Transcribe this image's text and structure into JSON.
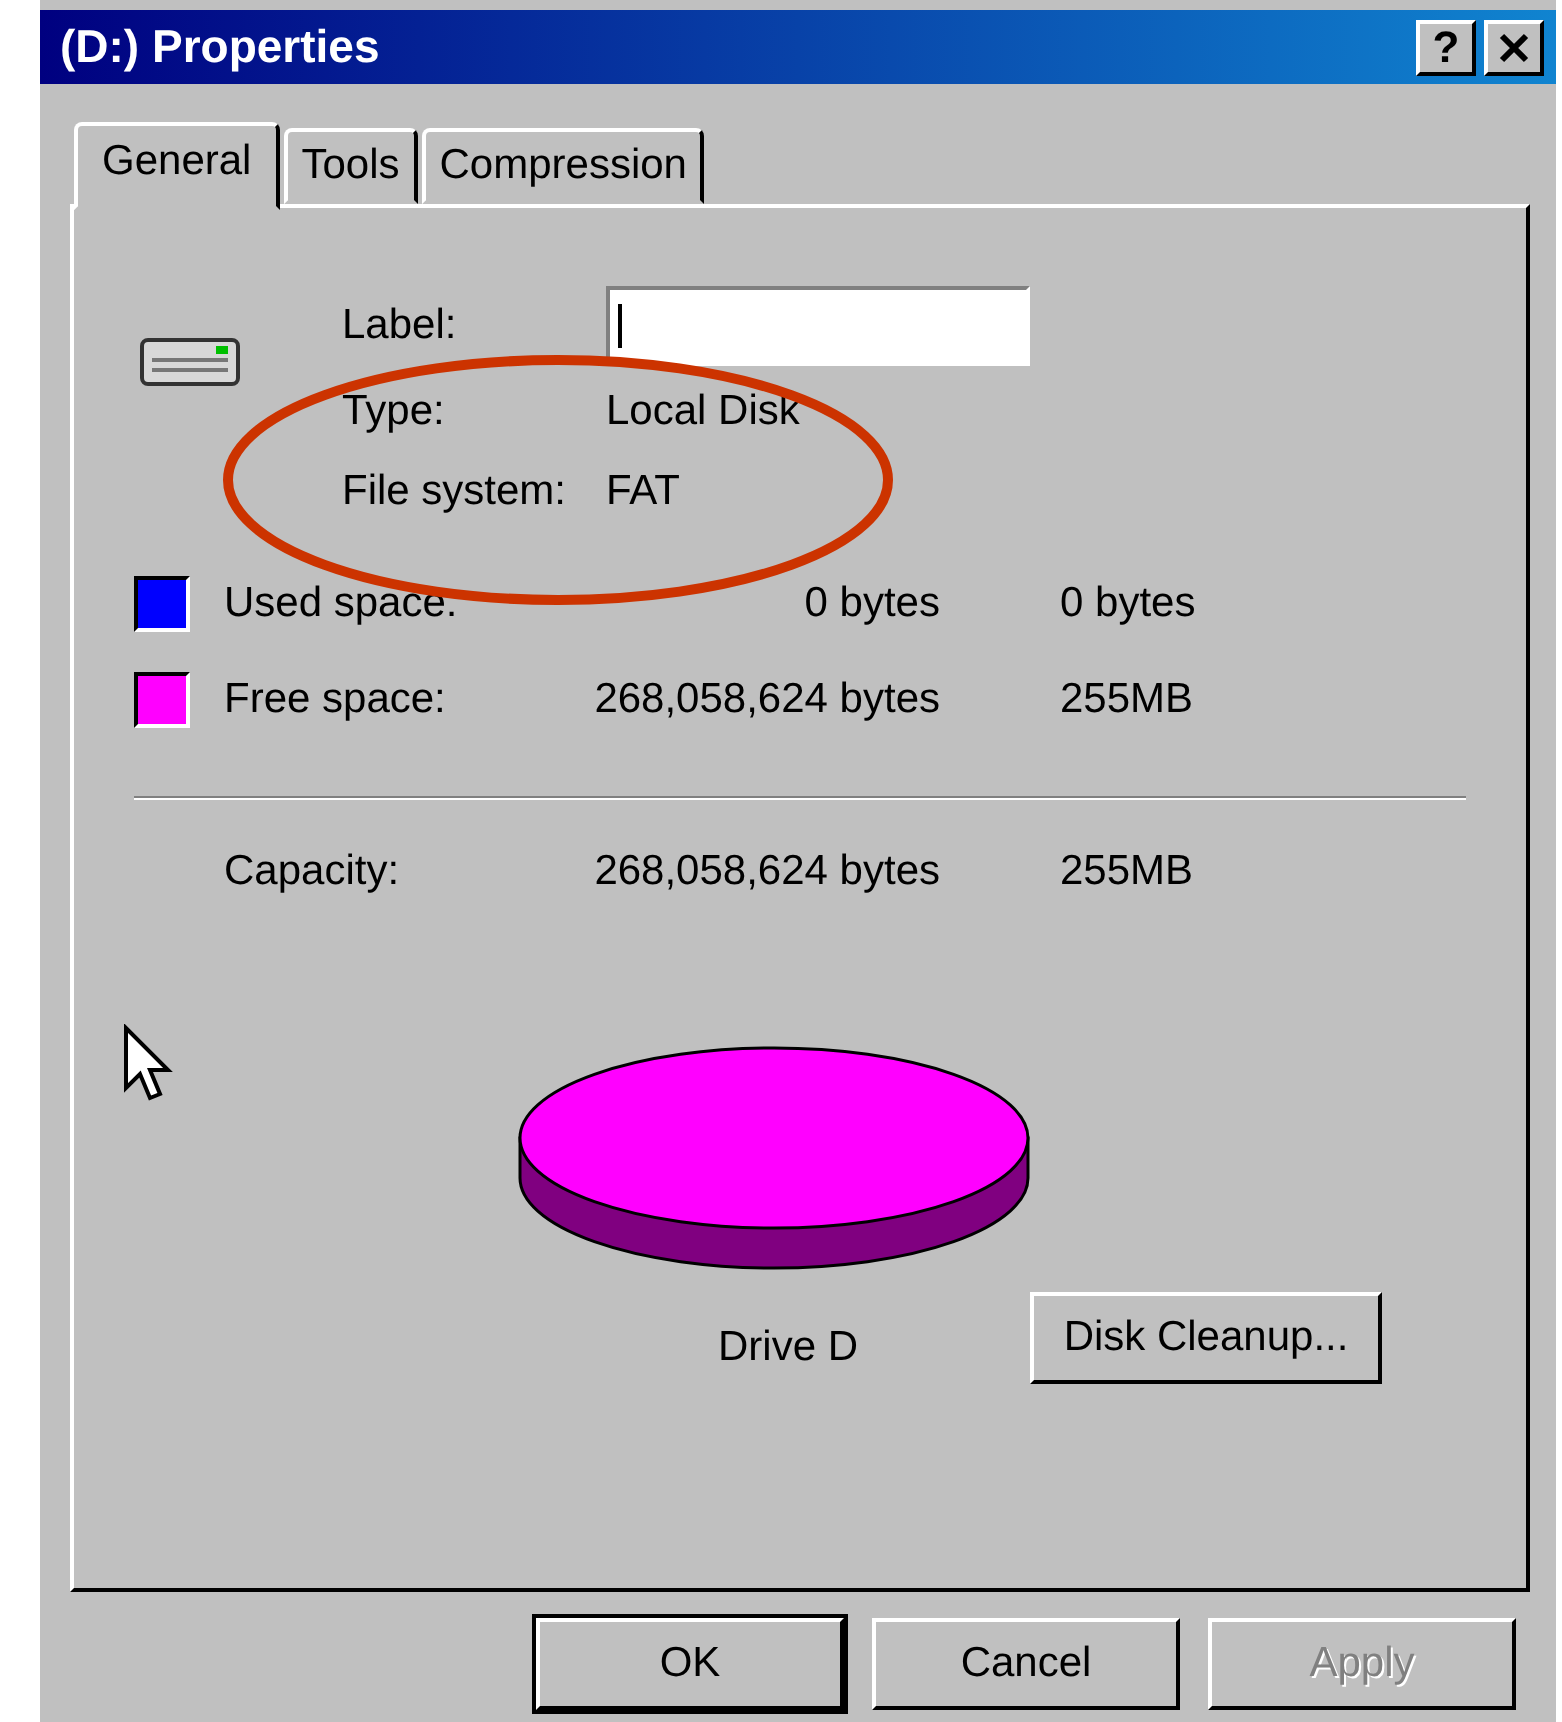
{
  "window": {
    "title": "(D:) Properties",
    "help_button": "?"
  },
  "tabs": [
    {
      "label": "General",
      "selected": true
    },
    {
      "label": "Tools",
      "selected": false
    },
    {
      "label": "Compression",
      "selected": false
    }
  ],
  "label_field": {
    "label": "Label:"
  },
  "info": [
    {
      "label": "Type:",
      "value": "Local Disk"
    },
    {
      "label": "File system:",
      "value": "FAT"
    }
  ],
  "space": [
    {
      "label": "Used space:",
      "bytes": "0 bytes",
      "size": "0 bytes",
      "color": "#0000ff"
    },
    {
      "label": "Free space:",
      "bytes": "268,058,624 bytes",
      "size": "255MB",
      "color": "#ff00ff"
    }
  ],
  "capacity": {
    "label": "Capacity:",
    "bytes": "268,058,624 bytes",
    "size": "255MB"
  },
  "chart_caption": "Drive D",
  "cleanup_button": "Disk Cleanup...",
  "annotation": {
    "kind": "ellipse"
  },
  "buttons": [
    {
      "label": "OK",
      "default": true,
      "disabled": false
    },
    {
      "label": "Cancel",
      "default": false,
      "disabled": false
    },
    {
      "label": "Apply",
      "default": false,
      "disabled": true
    }
  ]
}
